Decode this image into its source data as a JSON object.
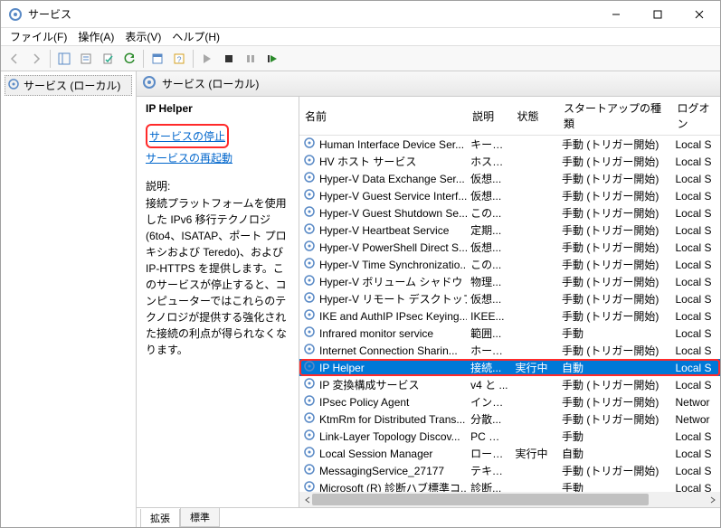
{
  "window": {
    "title": "サービス"
  },
  "menu": {
    "file": "ファイル(F)",
    "action": "操作(A)",
    "view": "表示(V)",
    "help": "ヘルプ(H)"
  },
  "tree": {
    "root": "サービス (ローカル)"
  },
  "header": {
    "title": "サービス (ローカル)"
  },
  "action_pane": {
    "title": "IP Helper",
    "stop_link": "サービスの停止",
    "restart_link": "サービスの再起動",
    "desc_label": "説明:",
    "desc_text": "接続プラットフォームを使用した IPv6 移行テクノロジ (6to4、ISATAP、ポート プロキシおよび Teredo)、および IP-HTTPS を提供します。このサービスが停止すると、コンピューターではこれらのテクノロジが提供する強化された接続の利点が得られなくなります。"
  },
  "columns": {
    "name": "名前",
    "description": "説明",
    "status": "状態",
    "startup": "スタートアップの種類",
    "logon": "ログオン"
  },
  "tabs": {
    "extended": "拡張",
    "standard": "標準"
  },
  "selected_index": 12,
  "services": [
    {
      "name": "Human Interface Device Ser...",
      "desc": "キーボ...",
      "status": "",
      "startup": "手動 (トリガー開始)",
      "logon": "Local S"
    },
    {
      "name": "HV ホスト サービス",
      "desc": "ホスト...",
      "status": "",
      "startup": "手動 (トリガー開始)",
      "logon": "Local S"
    },
    {
      "name": "Hyper-V Data Exchange Ser...",
      "desc": "仮想...",
      "status": "",
      "startup": "手動 (トリガー開始)",
      "logon": "Local S"
    },
    {
      "name": "Hyper-V Guest Service Interf...",
      "desc": "仮想...",
      "status": "",
      "startup": "手動 (トリガー開始)",
      "logon": "Local S"
    },
    {
      "name": "Hyper-V Guest Shutdown Se...",
      "desc": "この...",
      "status": "",
      "startup": "手動 (トリガー開始)",
      "logon": "Local S"
    },
    {
      "name": "Hyper-V Heartbeat Service",
      "desc": "定期...",
      "status": "",
      "startup": "手動 (トリガー開始)",
      "logon": "Local S"
    },
    {
      "name": "Hyper-V PowerShell Direct S...",
      "desc": "仮想...",
      "status": "",
      "startup": "手動 (トリガー開始)",
      "logon": "Local S"
    },
    {
      "name": "Hyper-V Time Synchronizatio...",
      "desc": "この...",
      "status": "",
      "startup": "手動 (トリガー開始)",
      "logon": "Local S"
    },
    {
      "name": "Hyper-V ボリューム シャドウ コピ...",
      "desc": "物理...",
      "status": "",
      "startup": "手動 (トリガー開始)",
      "logon": "Local S"
    },
    {
      "name": "Hyper-V リモート デスクトップ仮...",
      "desc": "仮想...",
      "status": "",
      "startup": "手動 (トリガー開始)",
      "logon": "Local S"
    },
    {
      "name": "IKE and AuthIP IPsec Keying...",
      "desc": "IKEE...",
      "status": "",
      "startup": "手動 (トリガー開始)",
      "logon": "Local S"
    },
    {
      "name": "Infrared monitor service",
      "desc": "範囲...",
      "status": "",
      "startup": "手動",
      "logon": "Local S"
    },
    {
      "name": "Internet Connection Sharin...",
      "desc": "ホーム...",
      "status": "",
      "startup": "手動 (トリガー開始)",
      "logon": "Local S"
    },
    {
      "name": "IP Helper",
      "desc": "接続...",
      "status": "実行中",
      "startup": "自動",
      "logon": "Local S"
    },
    {
      "name": "IP 変換構成サービス",
      "desc": "v4 と ...",
      "status": "",
      "startup": "手動 (トリガー開始)",
      "logon": "Local S"
    },
    {
      "name": "IPsec Policy Agent",
      "desc": "インタ...",
      "status": "",
      "startup": "手動 (トリガー開始)",
      "logon": "Networ"
    },
    {
      "name": "KtmRm for Distributed Trans...",
      "desc": "分散...",
      "status": "",
      "startup": "手動 (トリガー開始)",
      "logon": "Networ"
    },
    {
      "name": "Link-Layer Topology Discov...",
      "desc": "PC と ...",
      "status": "",
      "startup": "手動",
      "logon": "Local S"
    },
    {
      "name": "Local Session Manager",
      "desc": "ローカ...",
      "status": "実行中",
      "startup": "自動",
      "logon": "Local S"
    },
    {
      "name": "MessagingService_27177",
      "desc": "テキス...",
      "status": "",
      "startup": "手動 (トリガー開始)",
      "logon": "Local S"
    },
    {
      "name": "Microsoft (R) 診断ハブ標準コ...",
      "desc": "診断...",
      "status": "",
      "startup": "手動",
      "logon": "Local S"
    }
  ]
}
